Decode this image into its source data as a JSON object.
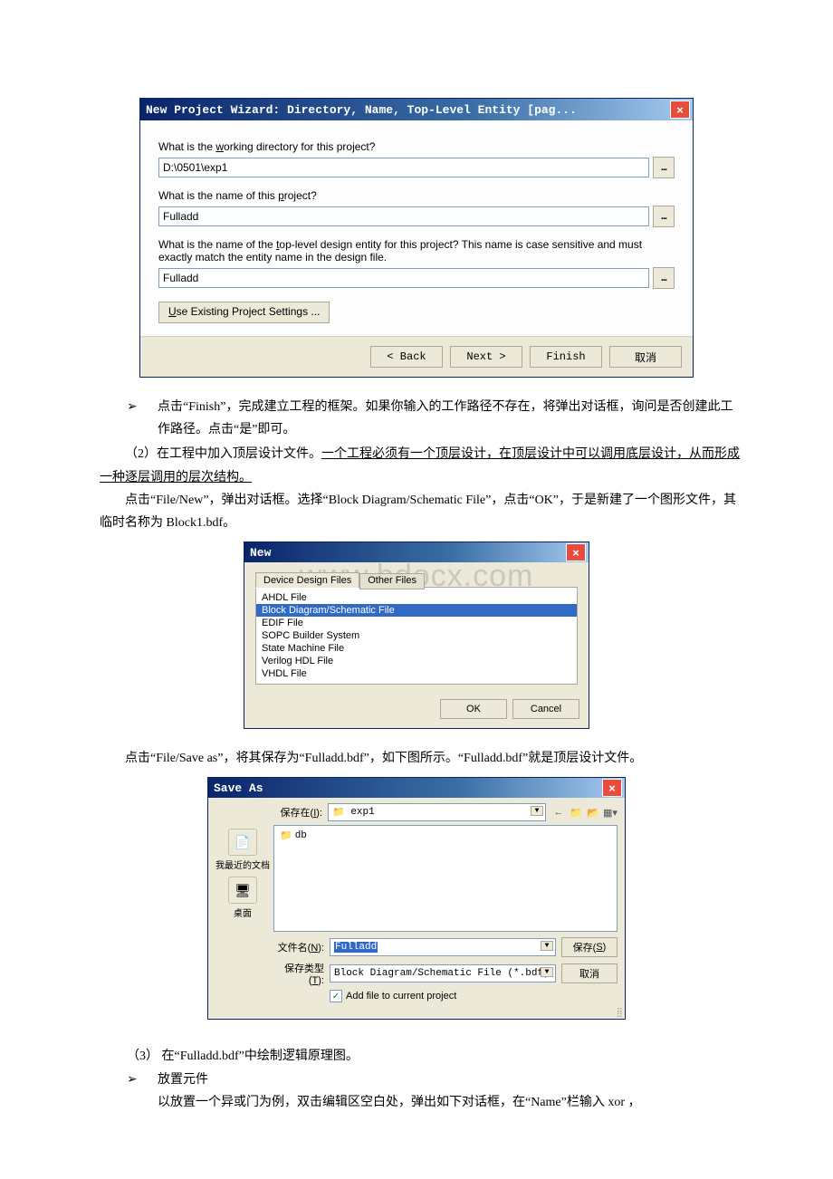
{
  "wizard": {
    "title": "New Project Wizard: Directory, Name, Top-Level Entity [pag...",
    "q1": "What is the working directory for this project?",
    "v1": "D:\\0501\\exp1",
    "q2": "What is the name of this project?",
    "v2": "Fulladd",
    "q3": "What is the name of the top-level design entity for this project? This name is case sensitive and must exactly match the entity name in the design file.",
    "v3": "Fulladd",
    "settings": "Use Existing Project Settings ...",
    "back": "< Back",
    "next": "Next >",
    "finish": "Finish",
    "cancel": "取消"
  },
  "text": {
    "p1a": "点击“Finish”，完成建立工程的框架。如果你输入的工作路径不存在，将弹出对话框，询问是否创建此工作路径。点击“是”即可。",
    "p2a": "（2）在工程中加入顶层设计文件。",
    "p2u": "一个工程必须有一个顶层设计，在顶层设计中可以调用底层设计，从而形成一种逐层调用的层次结构。",
    "p3": "点击“File/New”，弹出对话框。选择“Block Diagram/Schematic File”，点击“OK”，于是新建了一个图形文件，其临时名称为 Block1.bdf。",
    "p4": "点击“File/Save as”，将其保存为“Fulladd.bdf”，如下图所示。“Fulladd.bdf”就是顶层设计文件。",
    "p5": "（3） 在“Fulladd.bdf”中绘制逻辑原理图。",
    "p6": "放置元件",
    "p7": "以放置一个异或门为例，双击编辑区空白处，弹出如下对话框，在“Name”栏输入 xor ，"
  },
  "newdlg": {
    "title": "New",
    "tab1": "Device Design Files",
    "tab2": "Other Files",
    "items": [
      "AHDL File",
      "Block Diagram/Schematic File",
      "EDIF File",
      "SOPC Builder System",
      "State Machine File",
      "Verilog HDL File",
      "VHDL File"
    ],
    "ok": "OK",
    "cancel": "Cancel"
  },
  "savedlg": {
    "title": "Save As",
    "savein_label": "保存在(I):",
    "savein_value": "exp1",
    "place1": "我最近的文档",
    "place2": "桌面",
    "folder": "db",
    "filename_label": "文件名(N):",
    "filename_value": "Fulladd",
    "filetype_label": "保存类型(T):",
    "filetype_value": "Block Diagram/Schematic File (*.bdf)",
    "save_btn": "保存(S)",
    "cancel_btn": "取消",
    "addfile": "Add file to current project"
  },
  "watermark": "www.bdocx.com"
}
